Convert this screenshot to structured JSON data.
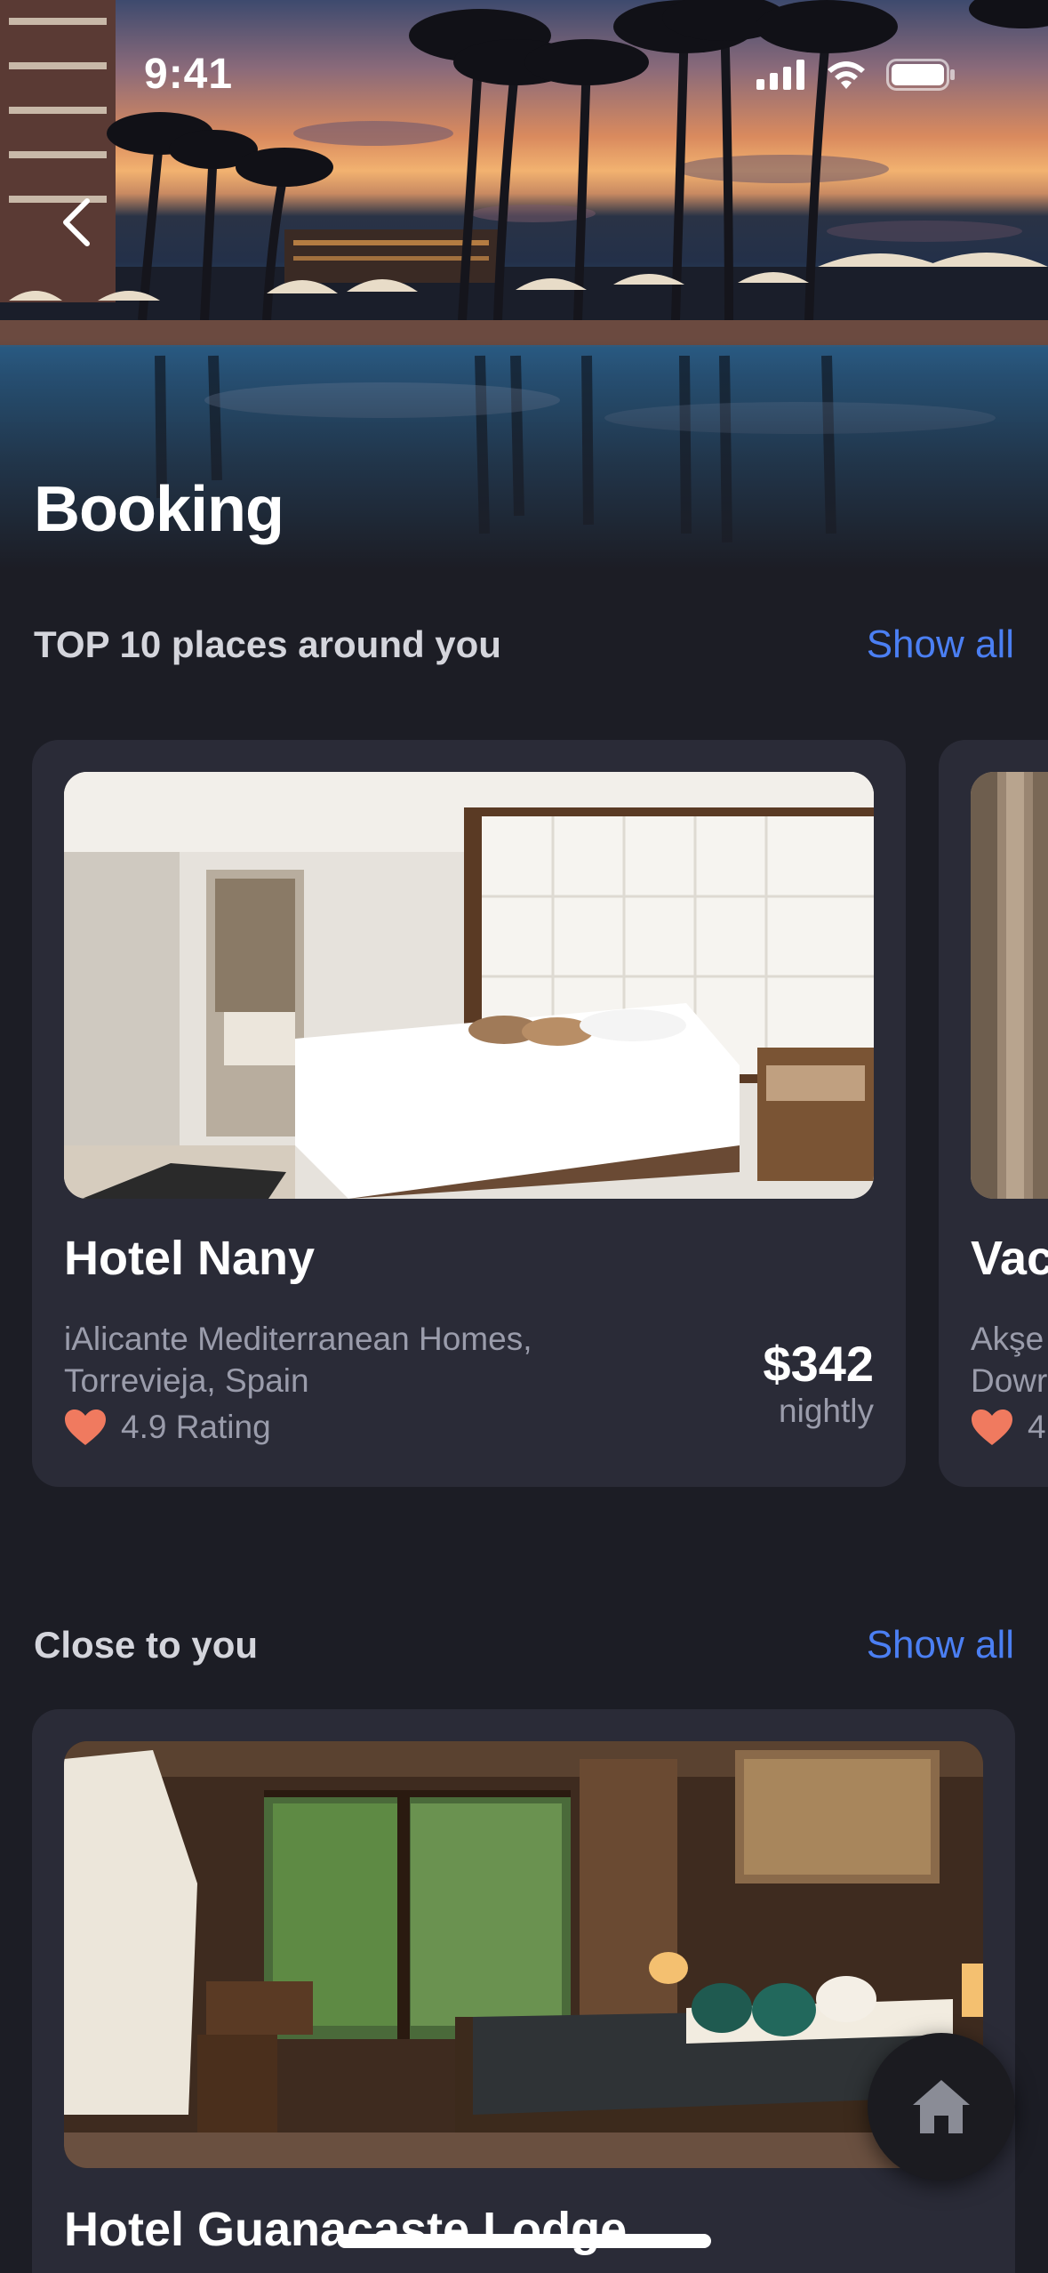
{
  "status_bar": {
    "time": "9:41",
    "icons": [
      "cellular-signal-icon",
      "wifi-icon",
      "battery-icon"
    ]
  },
  "header": {
    "back_icon": "chevron-left-icon",
    "title": "Booking"
  },
  "top_section": {
    "title": "TOP 10 places around you",
    "show_all": "Show all",
    "cards": [
      {
        "name": "Hotel Nany",
        "address": "iAlicante Mediterranean Homes, Torrevieja, Spain",
        "rating": "4.9 Rating",
        "price": "$342",
        "price_unit": "nightly"
      },
      {
        "name": "Vac",
        "address_line1": "Akşe",
        "address_line2": "Dowr",
        "rating": "4."
      }
    ]
  },
  "close_section": {
    "title": "Close to you",
    "show_all": "Show all",
    "cards": [
      {
        "name": "Hotel Guanacaste Lodge"
      }
    ]
  },
  "fab": {
    "icon": "home-icon"
  },
  "colors": {
    "background": "#1c1d25",
    "card": "#2a2b37",
    "accent": "#4b7ff3",
    "heart": "#f07a5f",
    "muted_text": "#9a9cab"
  }
}
